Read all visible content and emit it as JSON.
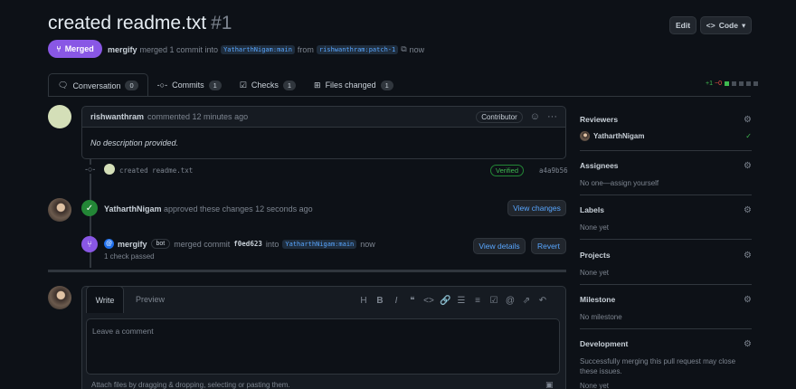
{
  "header": {
    "title": "created readme.txt",
    "number": "#1",
    "edit_label": "Edit",
    "code_label": "Code",
    "status": "Merged",
    "author": "mergify",
    "action": "merged 1 commit into",
    "base_branch": "YatharthNigam:main",
    "from_label": "from",
    "head_branch": "rishwanthram:patch-1",
    "time": "now"
  },
  "tabs": [
    {
      "label": "Conversation",
      "count": "0"
    },
    {
      "label": "Commits",
      "count": "1"
    },
    {
      "label": "Checks",
      "count": "1"
    },
    {
      "label": "Files changed",
      "count": "1"
    }
  ],
  "diffstat": {
    "add": "+1",
    "del": "−0"
  },
  "comment": {
    "author": "rishwanthram",
    "meta": "commented 12 minutes ago",
    "role": "Contributor",
    "body": "No description provided."
  },
  "commit": {
    "message": "created readme.txt",
    "status": "Verified",
    "sha": "a4a9b56"
  },
  "review": {
    "author": "YatharthNigam",
    "text": "approved these changes 12 seconds ago",
    "button": "View changes"
  },
  "merge_event": {
    "author": "mergify",
    "bot": "bot",
    "text": "merged commit",
    "sha": "f0ed623",
    "into": "into",
    "branch": "YatharthNigam:main",
    "time": "now",
    "checks": "1 check passed",
    "details_button": "View details",
    "revert_button": "Revert"
  },
  "editor": {
    "write_tab": "Write",
    "preview_tab": "Preview",
    "placeholder": "Leave a comment",
    "attach": "Attach files by dragging & dropping, selecting or pasting them."
  },
  "sidebar": {
    "reviewers": {
      "title": "Reviewers",
      "name": "YatharthNigam"
    },
    "assignees": {
      "title": "Assignees",
      "value": "No one—assign yourself"
    },
    "labels": {
      "title": "Labels",
      "value": "None yet"
    },
    "projects": {
      "title": "Projects",
      "value": "None yet"
    },
    "milestone": {
      "title": "Milestone",
      "value": "No milestone"
    },
    "development": {
      "title": "Development",
      "value": "Successfully merging this pull request may close these issues.",
      "extra": "None yet"
    }
  },
  "colors": {
    "merged": "#8957e5",
    "approved": "#238636",
    "link": "#58a6ff",
    "background": "#0d1117"
  }
}
